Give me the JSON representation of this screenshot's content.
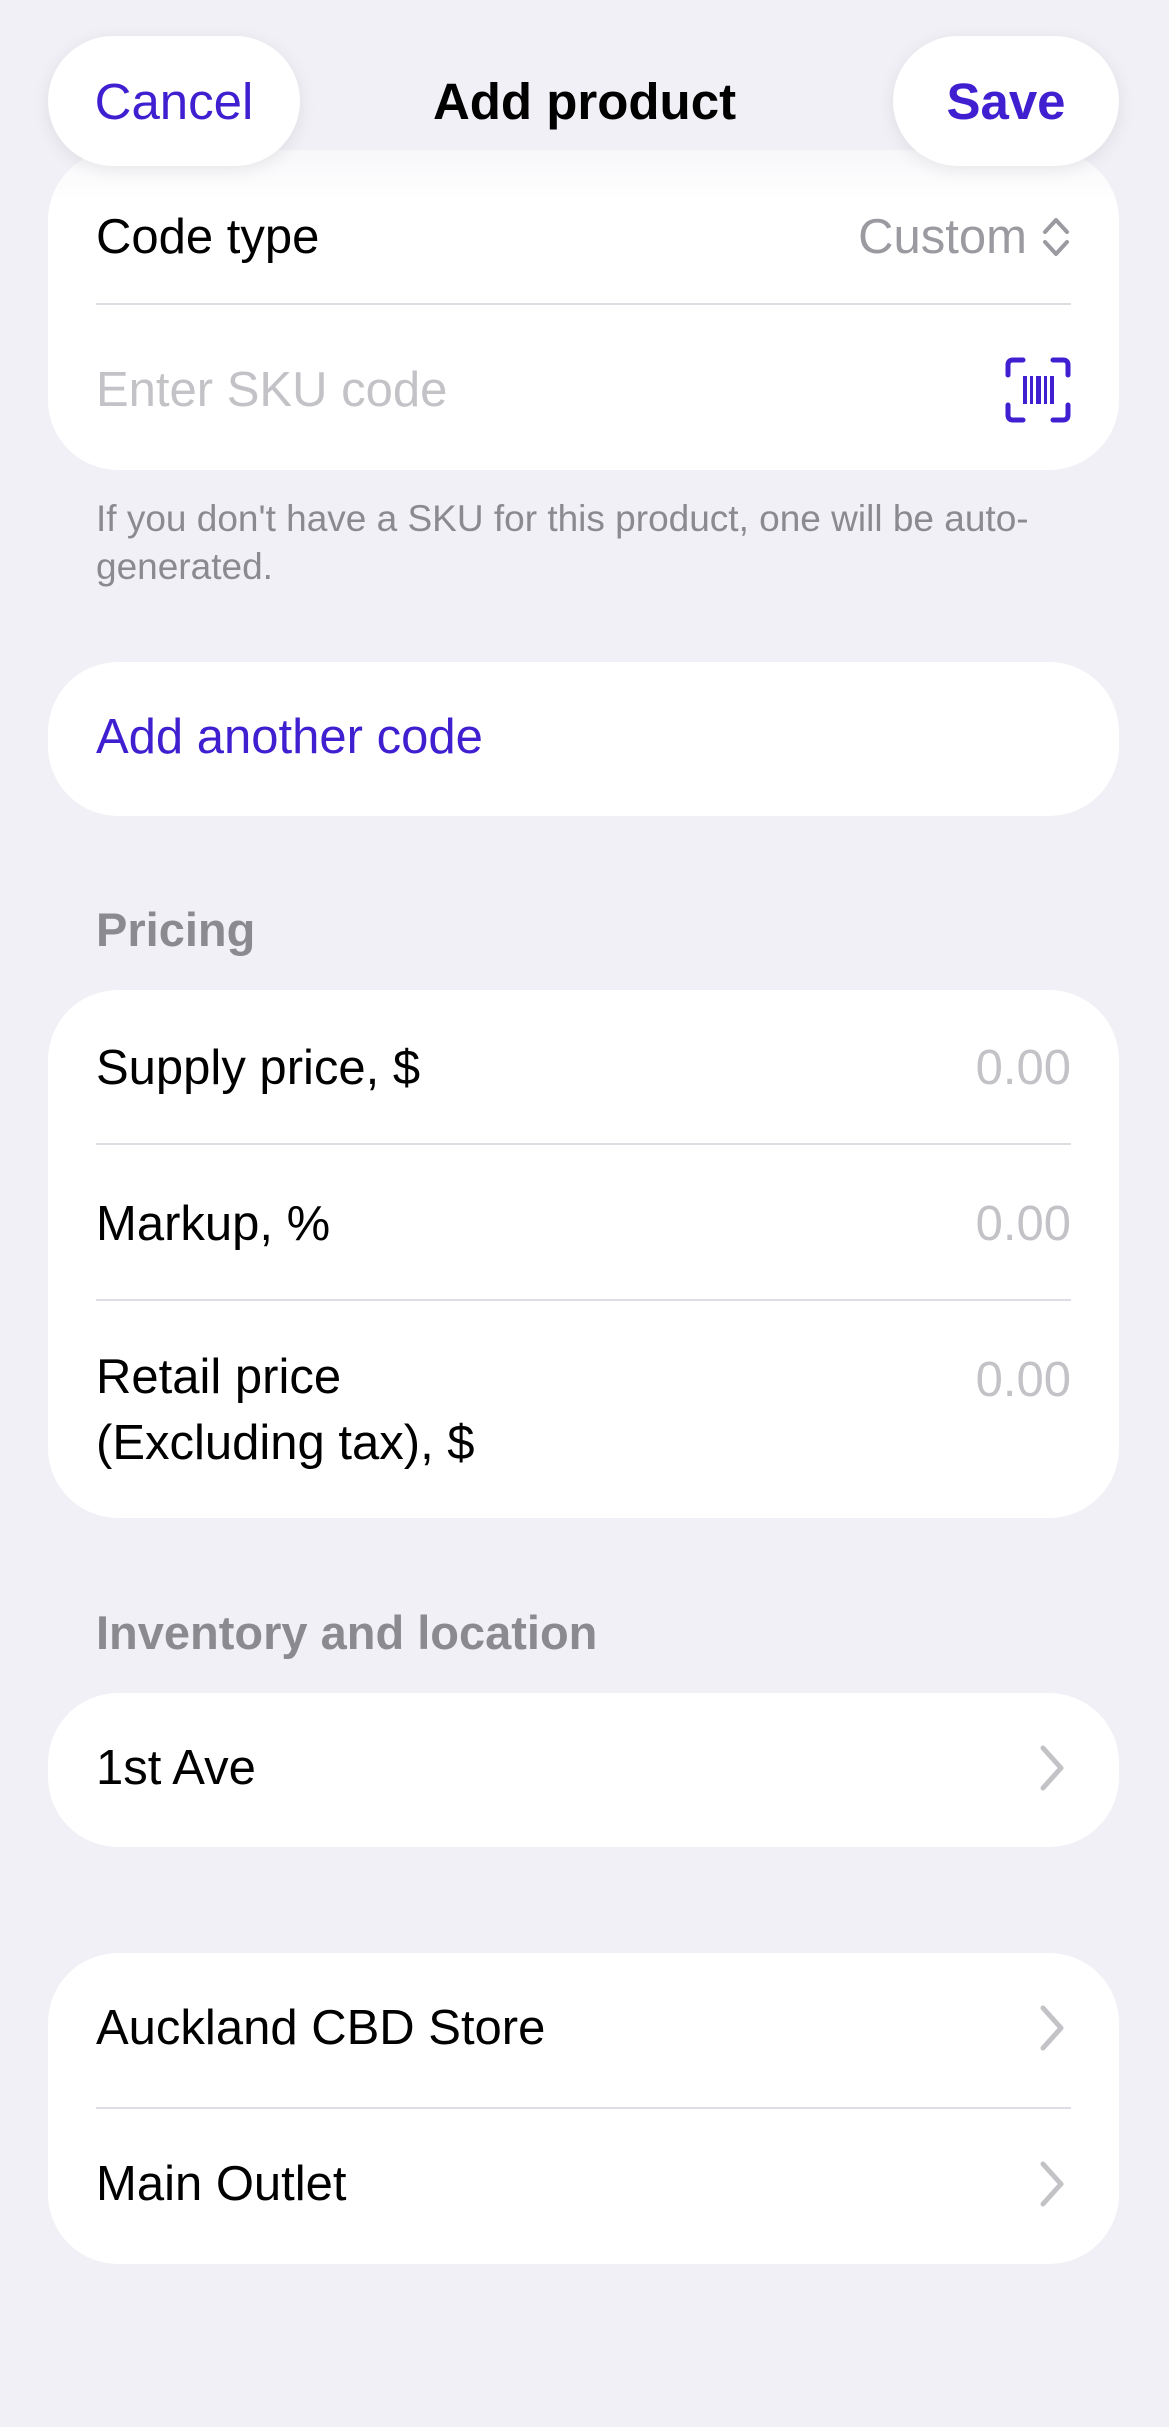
{
  "nav": {
    "cancel_label": "Cancel",
    "title": "Add product",
    "save_label": "Save"
  },
  "codes": {
    "code_type_label": "Code type",
    "code_type_value": "Custom",
    "sku_placeholder": "Enter SKU code",
    "sku_note": "If you don't have a SKU for this product, one will be auto-generated.",
    "add_code_label": "Add another code"
  },
  "pricing": {
    "header": "Pricing",
    "supply_label": "Supply price, $",
    "supply_value": "0.00",
    "markup_label": "Markup, %",
    "markup_value": "0.00",
    "retail_label_line1": "Retail price",
    "retail_label_line2": "(Excluding tax), $",
    "retail_value": "0.00"
  },
  "inventory": {
    "header": "Inventory and location",
    "locations": [
      "1st Ave",
      "Auckland CBD Store",
      "Main Outlet"
    ]
  },
  "colors": {
    "accent": "#3f1fd0",
    "background": "#f1f0f6"
  },
  "icons": {
    "scan": "barcode-scan-icon",
    "chevron": "chevron-right-icon",
    "sort": "up-down-chevron-icon"
  }
}
